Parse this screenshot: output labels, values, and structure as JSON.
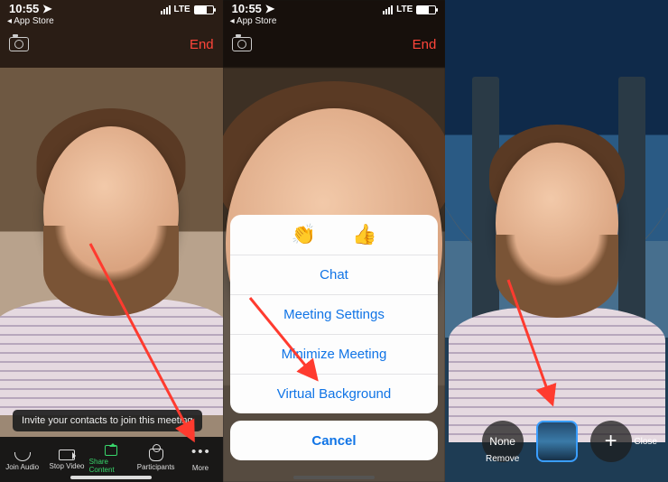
{
  "status": {
    "time": "10:55",
    "back": "App Store",
    "carrier": "LTE"
  },
  "topbar": {
    "end": "End"
  },
  "toast": "Invite your contacts to join this meeting",
  "toolbar": {
    "join_audio": "Join Audio",
    "stop_video": "Stop Video",
    "share": "Share Content",
    "participants": "Participants",
    "more": "More"
  },
  "sheet": {
    "emoji_clap": "👏",
    "emoji_thumb": "👍",
    "chat": "Chat",
    "settings": "Meeting Settings",
    "minimize": "Minimize Meeting",
    "virtualbg": "Virtual Background",
    "cancel": "Cancel"
  },
  "dock": {
    "none": "None",
    "remove": "Remove",
    "close": "Close",
    "plus": "+"
  }
}
